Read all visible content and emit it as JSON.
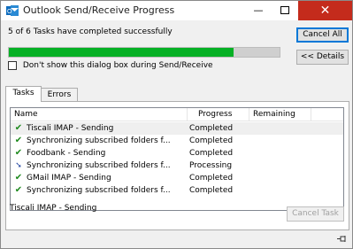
{
  "window": {
    "title": "Outlook Send/Receive Progress",
    "close_glyph": "✕",
    "min_glyph": "—"
  },
  "status_text": "5 of 6 Tasks have completed successfully",
  "overall_progress_fraction": 0.83,
  "buttons": {
    "cancel_all": "Cancel All",
    "details": "<< Details",
    "cancel_task": "Cancel Task"
  },
  "checkbox": {
    "label": "Don't show this dialog box during Send/Receive",
    "checked": false
  },
  "tabs": [
    {
      "label": "Tasks",
      "active": true
    },
    {
      "label": "Errors",
      "active": false
    }
  ],
  "columns": {
    "name": "Name",
    "progress": "Progress",
    "remaining": "Remaining"
  },
  "rows": [
    {
      "icon": "check-icon",
      "name": "Tiscali IMAP - Sending",
      "progress": "Completed",
      "remaining": ""
    },
    {
      "icon": "check-icon",
      "name": "Synchronizing subscribed folders f...",
      "progress": "Completed",
      "remaining": ""
    },
    {
      "icon": "check-icon",
      "name": "Foodbank - Sending",
      "progress": "Completed",
      "remaining": ""
    },
    {
      "icon": "arrow-icon",
      "name": "Synchronizing subscribed folders f...",
      "progress": "Processing",
      "remaining": ""
    },
    {
      "icon": "check-icon",
      "name": "GMail IMAP - Sending",
      "progress": "Completed",
      "remaining": ""
    },
    {
      "icon": "check-icon",
      "name": "Synchronizing subscribed folders f...",
      "progress": "Completed",
      "remaining": ""
    }
  ],
  "selected_task_label": "Tiscali IMAP - Sending",
  "colors": {
    "progress_fill": "#06b025",
    "close_button": "#c42b1c",
    "check": "#1e8a1e"
  }
}
